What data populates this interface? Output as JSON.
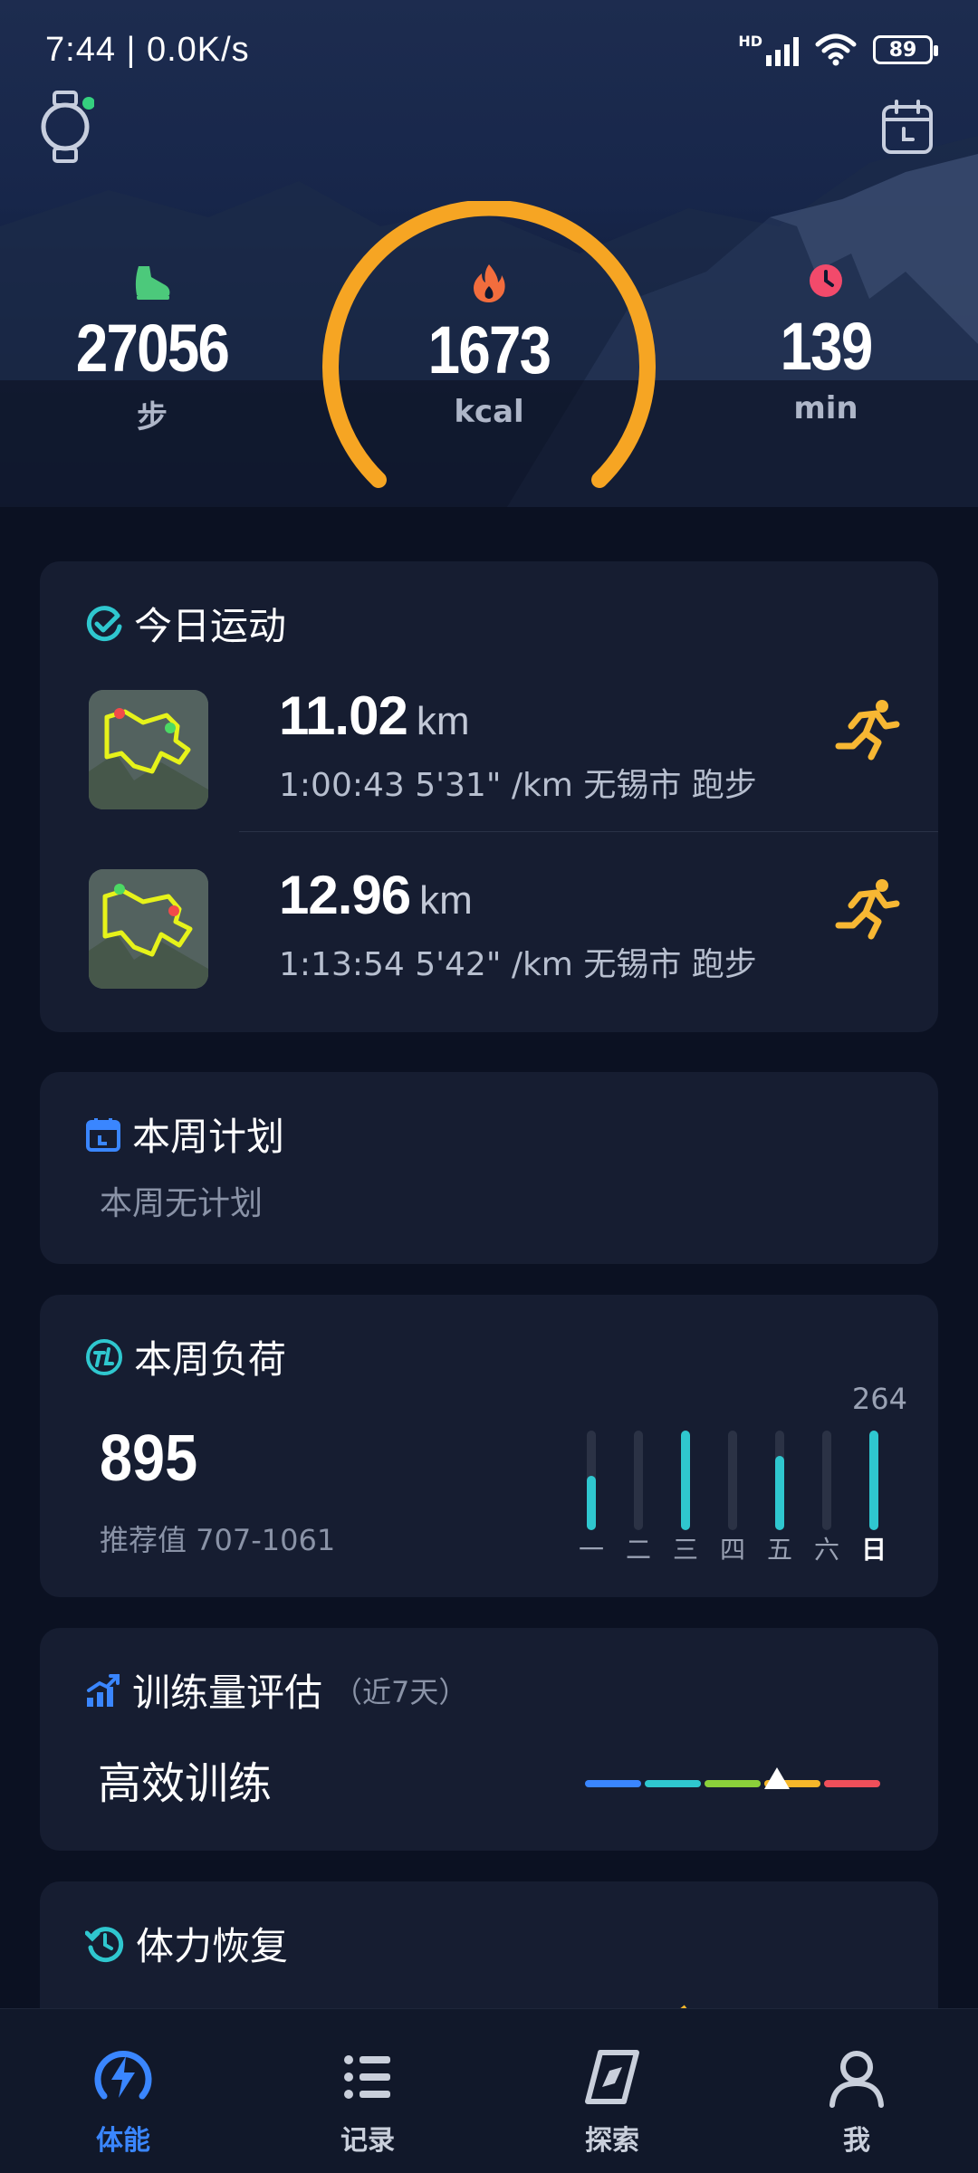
{
  "status_bar": {
    "time": "7:44 | 0.0K/s",
    "network": "HD",
    "battery": "89"
  },
  "summary": {
    "steps": {
      "value": "27056",
      "unit": "步"
    },
    "calories": {
      "value": "1673",
      "unit": "kcal"
    },
    "minutes": {
      "value": "139",
      "unit": "min"
    }
  },
  "today": {
    "title": "今日运动",
    "activities": [
      {
        "distance": "11.02",
        "unit": "km",
        "meta": "1:00:43  5'31\" /km  无锡市 跑步"
      },
      {
        "distance": "12.96",
        "unit": "km",
        "meta": "1:13:54  5'42\" /km  无锡市 跑步"
      }
    ]
  },
  "plan": {
    "title": "本周计划",
    "empty": "本周无计划"
  },
  "load": {
    "title": "本周负荷",
    "value": "895",
    "recommend": "推荐值 707-1061",
    "max_label": "264",
    "days": [
      "一",
      "二",
      "三",
      "四",
      "五",
      "六",
      "日"
    ],
    "levels": [
      0.55,
      0,
      1.0,
      0,
      0.75,
      0,
      1.0
    ]
  },
  "training": {
    "title": "训练量评估",
    "subtitle": "（近7天）",
    "status": "高效训练",
    "scale_position": 0.65
  },
  "recovery": {
    "title": "体力恢复"
  },
  "tabs": [
    {
      "label": "体能",
      "icon": "bolt-icon"
    },
    {
      "label": "记录",
      "icon": "list-icon"
    },
    {
      "label": "探索",
      "icon": "compass-icon"
    },
    {
      "label": "我",
      "icon": "user-icon"
    }
  ],
  "colors": {
    "accent_ring": "#f6a523",
    "teal": "#2fc7cf",
    "active_tab": "#3a86ff",
    "runner": "#f7b733"
  }
}
